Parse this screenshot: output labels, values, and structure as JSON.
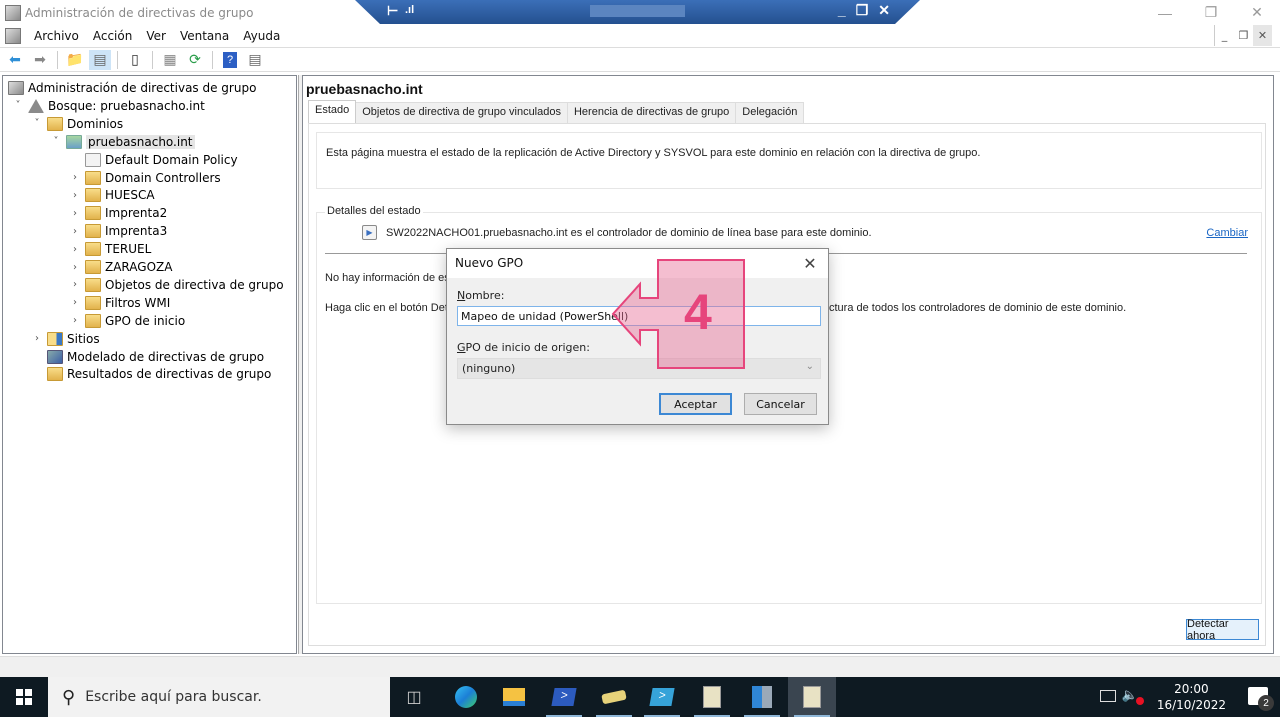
{
  "window": {
    "title": "Administración de directivas de grupo",
    "controls": [
      "minimize",
      "restore",
      "close"
    ]
  },
  "rdp_bar": {
    "pin_icon": "pin-icon",
    "signal_icon": "signal-icon",
    "host_name_redacted": true
  },
  "menu": {
    "items": [
      "Archivo",
      "Acción",
      "Ver",
      "Ventana",
      "Ayuda"
    ]
  },
  "toolbar": {
    "buttons": [
      "back-icon",
      "forward-icon",
      "up-folder-icon",
      "show-hide-console-tree-icon",
      "clipboard-icon",
      "properties-icon",
      "refresh-icon",
      "help-icon",
      "action-pane-icon"
    ]
  },
  "tree": {
    "items": [
      {
        "label": "Administración de directivas de grupo",
        "icon": "gpmc-icon",
        "level": 0,
        "expander": ""
      },
      {
        "label": "Bosque: pruebasnacho.int",
        "icon": "forest-icon",
        "level": 1,
        "expander": "expanded"
      },
      {
        "label": "Dominios",
        "icon": "domains-folder-icon",
        "level": 2,
        "expander": "expanded"
      },
      {
        "label": "pruebasnacho.int",
        "icon": "domain-icon",
        "level": 3,
        "expander": "expanded",
        "selected": true
      },
      {
        "label": "Default Domain Policy",
        "icon": "gpo-link-icon",
        "level": 4,
        "expander": ""
      },
      {
        "label": "Domain Controllers",
        "icon": "ou-icon",
        "level": 4,
        "expander": "collapsed"
      },
      {
        "label": "HUESCA",
        "icon": "ou-icon",
        "level": 4,
        "expander": "collapsed"
      },
      {
        "label": "Imprenta2",
        "icon": "ou-icon",
        "level": 4,
        "expander": "collapsed"
      },
      {
        "label": "Imprenta3",
        "icon": "ou-icon",
        "level": 4,
        "expander": "collapsed"
      },
      {
        "label": "TERUEL",
        "icon": "ou-icon",
        "level": 4,
        "expander": "collapsed"
      },
      {
        "label": "ZARAGOZA",
        "icon": "ou-icon",
        "level": 4,
        "expander": "collapsed"
      },
      {
        "label": "Objetos de directiva de grupo",
        "icon": "gpo-folder-icon",
        "level": 4,
        "expander": "collapsed"
      },
      {
        "label": "Filtros WMI",
        "icon": "wmi-folder-icon",
        "level": 4,
        "expander": "collapsed"
      },
      {
        "label": "GPO de inicio",
        "icon": "starter-gpo-folder-icon",
        "level": 4,
        "expander": "collapsed"
      },
      {
        "label": "Sitios",
        "icon": "sites-icon",
        "level": 2,
        "expander": "collapsed"
      },
      {
        "label": "Modelado de directivas de grupo",
        "icon": "modeling-icon",
        "level": 2,
        "expander": ""
      },
      {
        "label": "Resultados de directivas de grupo",
        "icon": "results-icon",
        "level": 2,
        "expander": ""
      }
    ]
  },
  "main": {
    "title": "pruebasnacho.int",
    "tabs": [
      {
        "label": "Estado",
        "active": true
      },
      {
        "label": "Objetos de directiva de grupo vinculados",
        "active": false
      },
      {
        "label": "Herencia de directivas de grupo",
        "active": false
      },
      {
        "label": "Delegación",
        "active": false
      }
    ],
    "info_text": "Esta página muestra el estado de la replicación de Active Directory y SYSVOL para este dominio en relación con la directiva de grupo.",
    "status_details": {
      "legend": "Detalles del estado",
      "baseline_text": "SW2022NACHO01.pruebasnacho.int es el controlador de dominio de línea base para este dominio.",
      "change_link": "Cambiar",
      "no_info_text": "No hay información de es",
      "click_text_left": "Haga clic en el botón Det",
      "click_text_right": "ctura de todos los controladores de dominio de este dominio."
    },
    "detect_button": "Detectar ahora"
  },
  "dialog": {
    "title": "Nuevo GPO",
    "name_label_accel": "N",
    "name_label_rest": "ombre:",
    "name_value": "Mapeo de unidad (PowerShell)",
    "source_label_accel": "G",
    "source_label_rest": "PO de inicio de origen:",
    "source_value": "(ninguno)",
    "ok_button": "Aceptar",
    "cancel_button": "Cancelar"
  },
  "annotation": {
    "step_number": "4",
    "color": "#e6457c"
  },
  "taskbar": {
    "search_placeholder": "Escribe aquí para buscar.",
    "apps": [
      {
        "name": "task-view-icon",
        "running": false
      },
      {
        "name": "edge-icon",
        "running": false
      },
      {
        "name": "file-explorer-icon",
        "running": false
      },
      {
        "name": "powershell-icon",
        "running": true
      },
      {
        "name": "drive-icon",
        "running": true
      },
      {
        "name": "powershell-ise-icon",
        "running": true
      },
      {
        "name": "gpmc-script-icon",
        "running": true
      },
      {
        "name": "server-manager-icon",
        "running": true
      },
      {
        "name": "gpmc-script-icon-2",
        "running": true,
        "current": true
      }
    ],
    "time": "20:00",
    "date": "16/10/2022",
    "notification_count": "2"
  }
}
